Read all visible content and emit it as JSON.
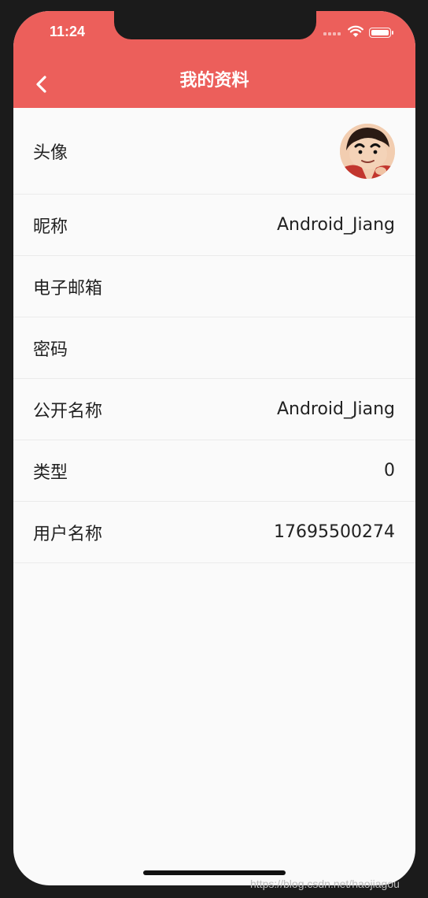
{
  "status_bar": {
    "time": "11:24"
  },
  "app_bar": {
    "title": "我的资料",
    "back_icon": "chevron-left-icon"
  },
  "profile_rows": [
    {
      "label": "头像",
      "type": "avatar"
    },
    {
      "label": "昵称",
      "value": "Android_Jiang"
    },
    {
      "label": "电子邮箱",
      "value": ""
    },
    {
      "label": "密码",
      "value": ""
    },
    {
      "label": "公开名称",
      "value": "Android_Jiang"
    },
    {
      "label": "类型",
      "value": "0"
    },
    {
      "label": "用户名称",
      "value": "17695500274"
    }
  ],
  "watermark": "https://blog.csdn.net/haojiagou",
  "colors": {
    "accent": "#ec5f5b",
    "background": "#fafafa",
    "divider": "#ebebeb"
  }
}
